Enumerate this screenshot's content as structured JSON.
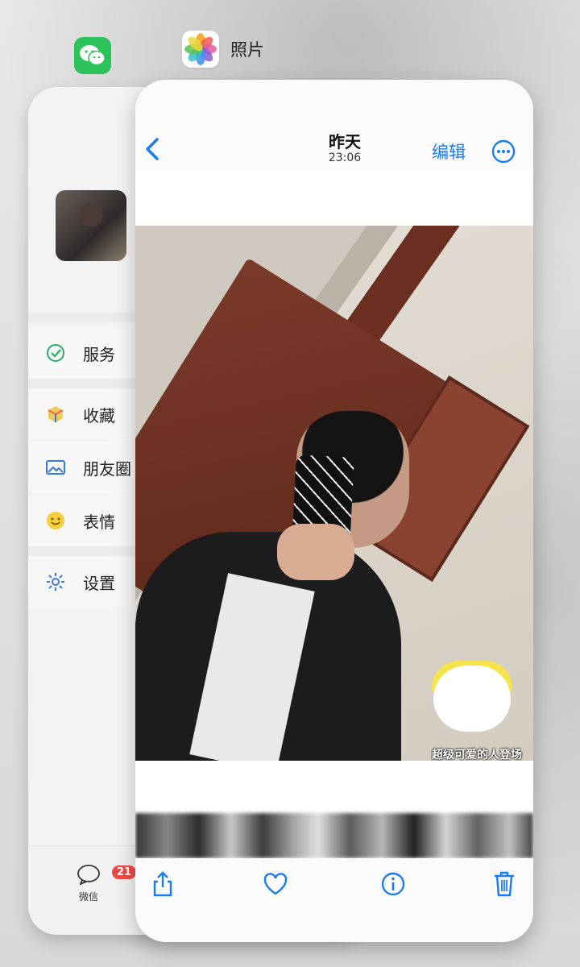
{
  "switcher": {
    "wechat_app_name": "",
    "photos_app_name": "照片"
  },
  "wechat": {
    "menu": [
      {
        "label": "服务",
        "icon": "check-circle-icon",
        "color": "#2aae67"
      },
      {
        "label": "收藏",
        "icon": "cube-icon",
        "color": "#e7b448"
      },
      {
        "label": "朋友圈",
        "icon": "image-icon",
        "color": "#3c7ad8"
      },
      {
        "label": "表情",
        "icon": "smile-icon",
        "color": "#f1c232"
      },
      {
        "label": "设置",
        "icon": "gear-icon",
        "color": "#3c7ad8"
      }
    ],
    "tab": {
      "label": "微信",
      "badge": "21"
    }
  },
  "photos": {
    "title_date": "昨天",
    "title_time": "23:06",
    "edit_label": "编辑",
    "sticker_caption": "超级可爱的人登场",
    "accent": "#1b7cf2"
  }
}
